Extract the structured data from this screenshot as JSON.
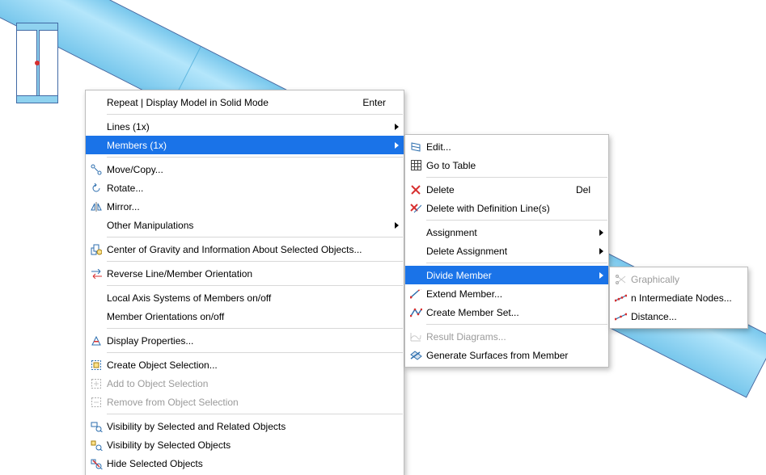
{
  "menu1": {
    "repeat": {
      "label": "Repeat | Display Model in Solid Mode",
      "shortcut": "Enter"
    },
    "lines": {
      "label": "Lines (1x)"
    },
    "members": {
      "label": "Members (1x)"
    },
    "move_copy": {
      "label": "Move/Copy..."
    },
    "rotate": {
      "label": "Rotate..."
    },
    "mirror": {
      "label": "Mirror..."
    },
    "other_manip": {
      "label": "Other Manipulations"
    },
    "cog": {
      "label": "Center of Gravity and Information About Selected Objects..."
    },
    "reverse": {
      "label": "Reverse Line/Member Orientation"
    },
    "local_axis": {
      "label": "Local Axis Systems of Members on/off"
    },
    "orientations": {
      "label": "Member Orientations on/off"
    },
    "display_props": {
      "label": "Display Properties..."
    },
    "create_sel": {
      "label": "Create Object Selection..."
    },
    "add_sel": {
      "label": "Add to Object Selection"
    },
    "remove_sel": {
      "label": "Remove from Object Selection"
    },
    "vis_related": {
      "label": "Visibility by Selected and Related Objects"
    },
    "vis_selected": {
      "label": "Visibility by Selected Objects"
    },
    "hide": {
      "label": "Hide Selected Objects"
    }
  },
  "menu2": {
    "edit": {
      "label": "Edit..."
    },
    "gototable": {
      "label": "Go to Table"
    },
    "delete": {
      "label": "Delete",
      "shortcut": "Del"
    },
    "delete_lines": {
      "label": "Delete with Definition Line(s)"
    },
    "assignment": {
      "label": "Assignment"
    },
    "del_assign": {
      "label": "Delete Assignment"
    },
    "divide": {
      "label": "Divide Member"
    },
    "extend": {
      "label": "Extend Member..."
    },
    "create_set": {
      "label": "Create Member Set..."
    },
    "result_diag": {
      "label": "Result Diagrams..."
    },
    "gen_surf": {
      "label": "Generate Surfaces from Member"
    }
  },
  "menu3": {
    "graphically": {
      "label": "Graphically"
    },
    "nnodes": {
      "label": "n Intermediate Nodes..."
    },
    "distance": {
      "label": "Distance..."
    }
  }
}
